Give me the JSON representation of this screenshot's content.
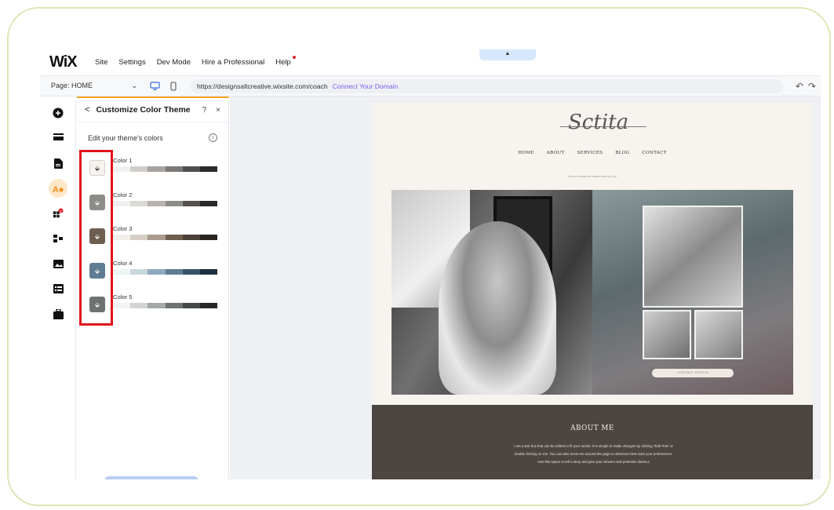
{
  "topbar": {
    "logo": "WiX",
    "menu": [
      "Site",
      "Settings",
      "Dev Mode",
      "Hire a Professional",
      "Help"
    ],
    "handle": "▲"
  },
  "pagebar": {
    "page_label": "Page: HOME",
    "url": "https://designsaltcreative.wixsite.com/coach",
    "connect_domain": "Connect Your Domain"
  },
  "panel": {
    "title": "Customize Color Theme",
    "help": "?",
    "close": "×",
    "back": "<",
    "edit_label": "Edit your theme's colors",
    "colors": [
      {
        "label": "Color 1",
        "swatch": "#f6f3ee",
        "shades": [
          "#f3f1ee",
          "#d1cdca",
          "#a6a29f",
          "#7b7876",
          "#4f4d4c",
          "#2b2a2a"
        ]
      },
      {
        "label": "Color 2",
        "swatch": "#8e8c89",
        "shades": [
          "#f1f0ee",
          "#dcdad7",
          "#b7b4b0",
          "#8e8c89",
          "#55524f",
          "#2c2a28"
        ]
      },
      {
        "label": "Color 3",
        "swatch": "#6d5e4f",
        "shades": [
          "#f2efeb",
          "#d6cfc6",
          "#a99c8f",
          "#6d5e4f",
          "#4b4036",
          "#2a241f"
        ]
      },
      {
        "label": "Color 4",
        "swatch": "#5e7d94",
        "shades": [
          "#eef3f6",
          "#c8d7e0",
          "#8fa9bc",
          "#5e7d94",
          "#345268",
          "#1c2f3e"
        ]
      },
      {
        "label": "Color 5",
        "swatch": "#6e7372",
        "shades": [
          "#f1f2f2",
          "#d2d5d4",
          "#a5aaa9",
          "#6e7372",
          "#464a49",
          "#252827"
        ]
      }
    ]
  },
  "site": {
    "signature": "Sctita",
    "nav": [
      "HOME",
      "ABOUT",
      "SERVICES",
      "BLOG",
      "CONTACT"
    ],
    "tagline": "this is a sentence about what you do",
    "contact_button": "CONTACT RUSTIN",
    "about_title": "ABOUT ME",
    "about_text": "I am a text box that can be edited to fit your needs. It is simple to make changes by clicking \"Edit Text\" or double clicking on me. You can also move me around the page to wherever best suits your preferences. Use this space to tell a story and give your viewers and potential clients a"
  }
}
